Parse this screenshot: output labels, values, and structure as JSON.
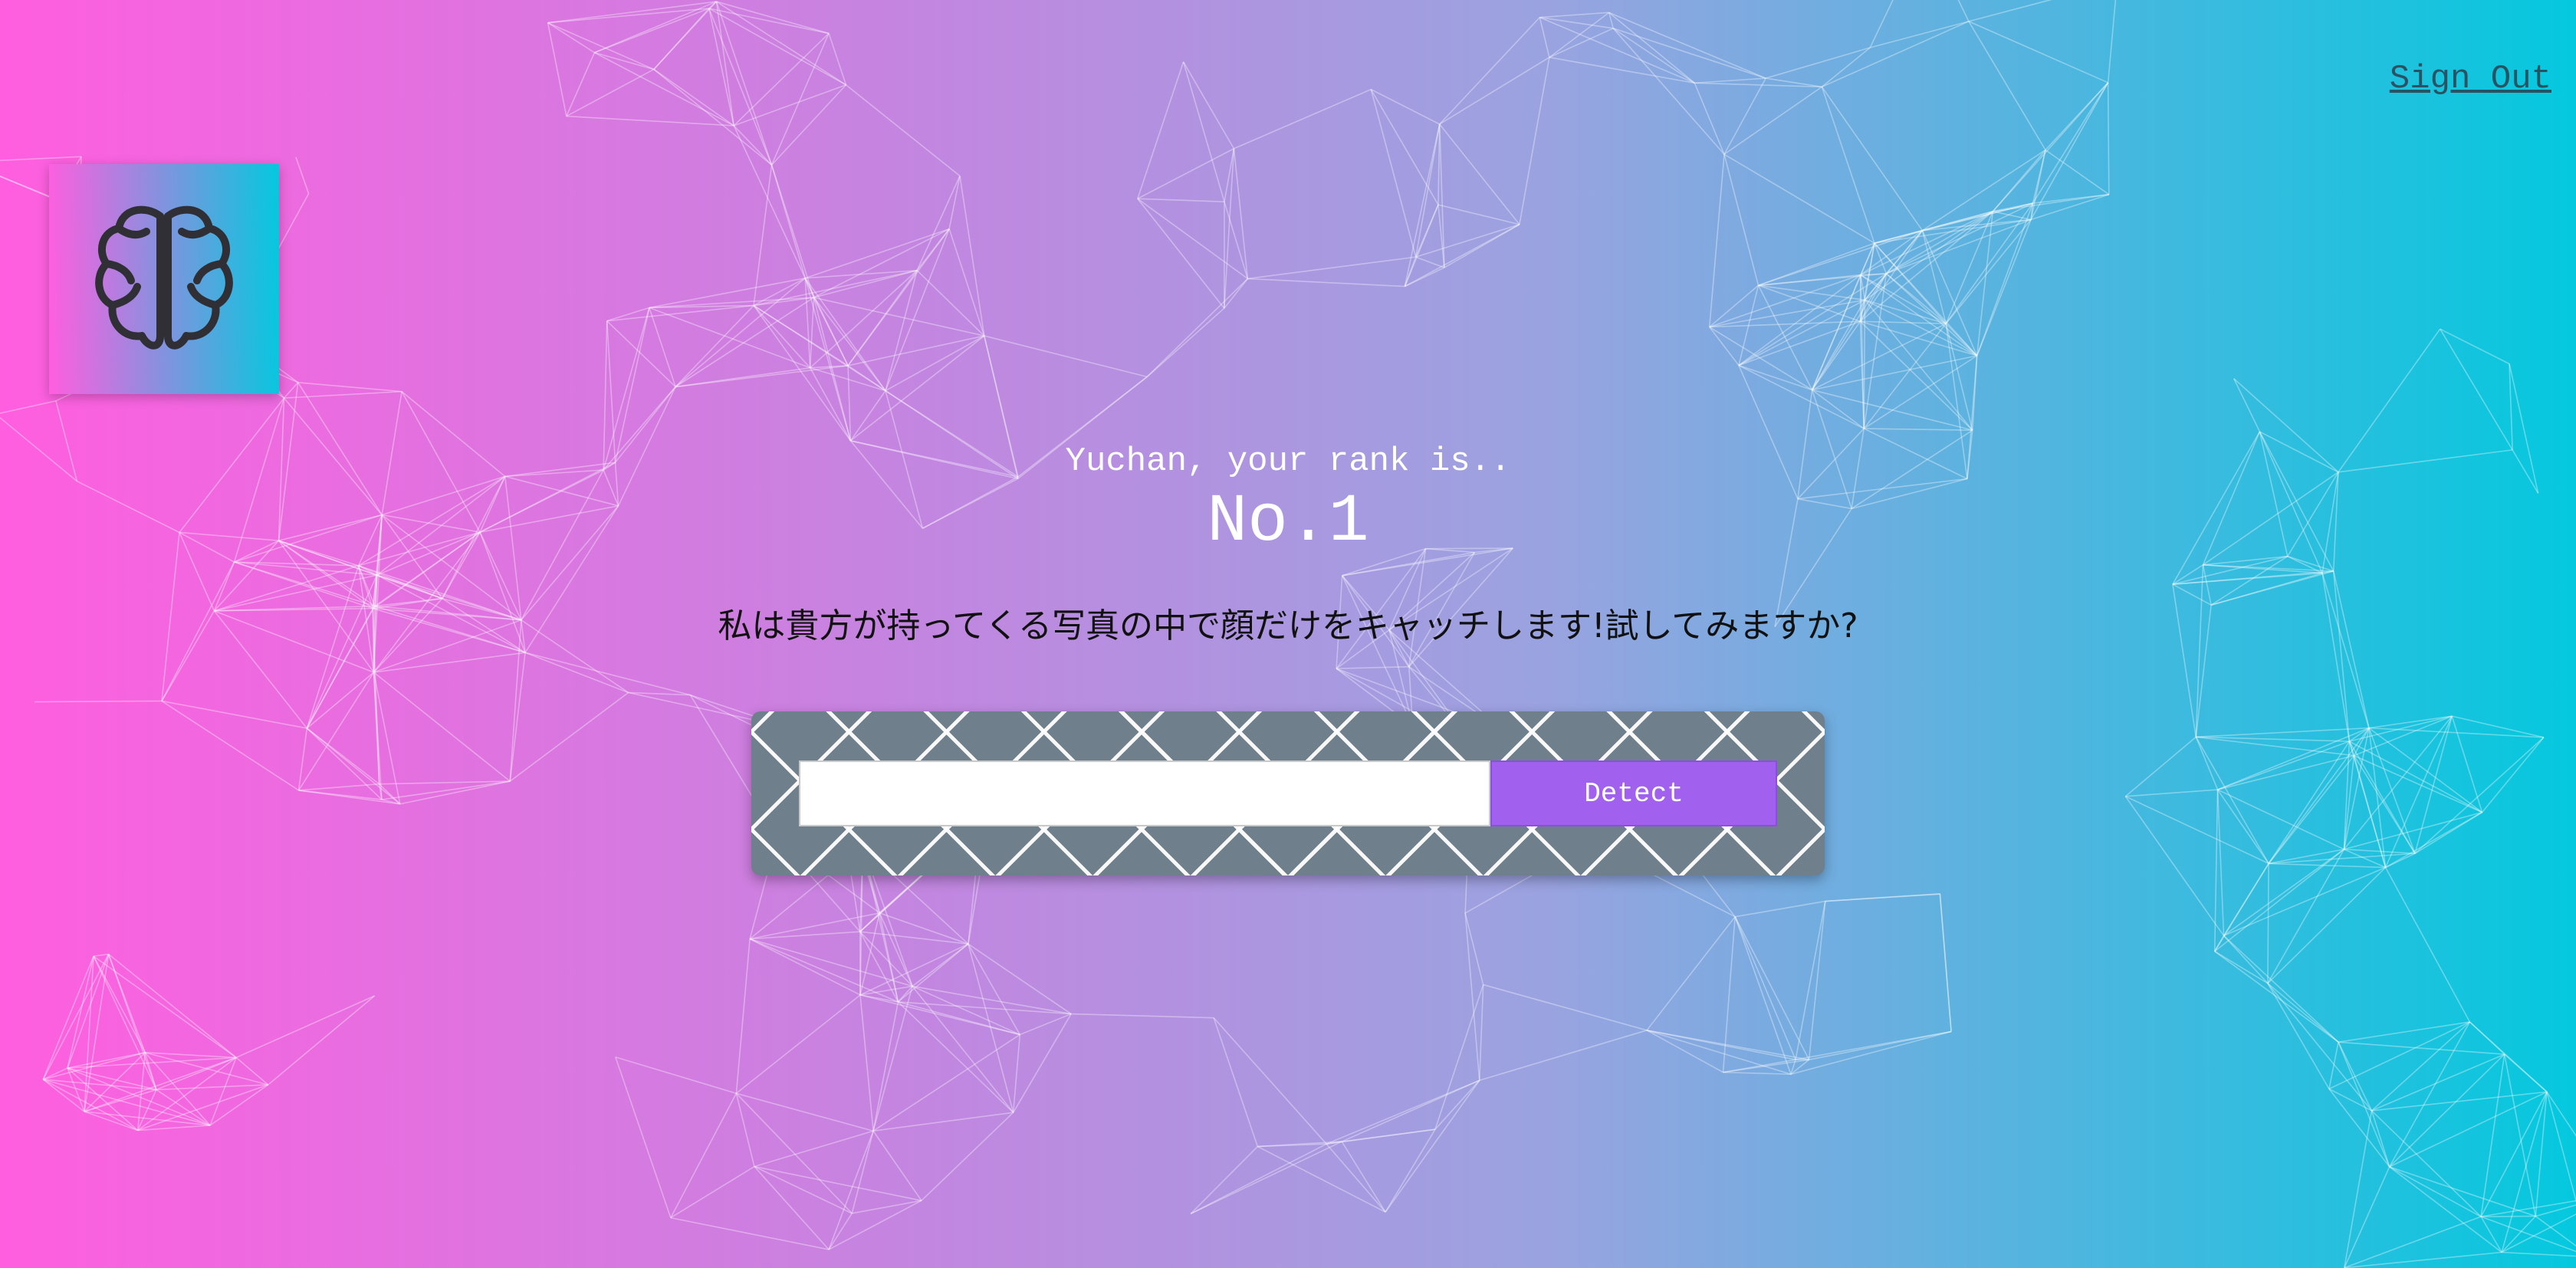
{
  "nav": {
    "signout_label": "Sign Out"
  },
  "logo": {
    "icon": "brain-icon"
  },
  "rank": {
    "line": "Yuchan, your rank is..",
    "value": "No.1"
  },
  "intro": {
    "text": "私は貴方が持ってくる写真の中で顔だけをキャッチします!試してみますか?"
  },
  "form": {
    "input_value": "",
    "input_placeholder": "",
    "button_label": "Detect"
  },
  "colors": {
    "gradient_start": "#ff5edf",
    "gradient_end": "#04c8de",
    "button": "#a160ed",
    "panel": "#6f7f8c"
  }
}
